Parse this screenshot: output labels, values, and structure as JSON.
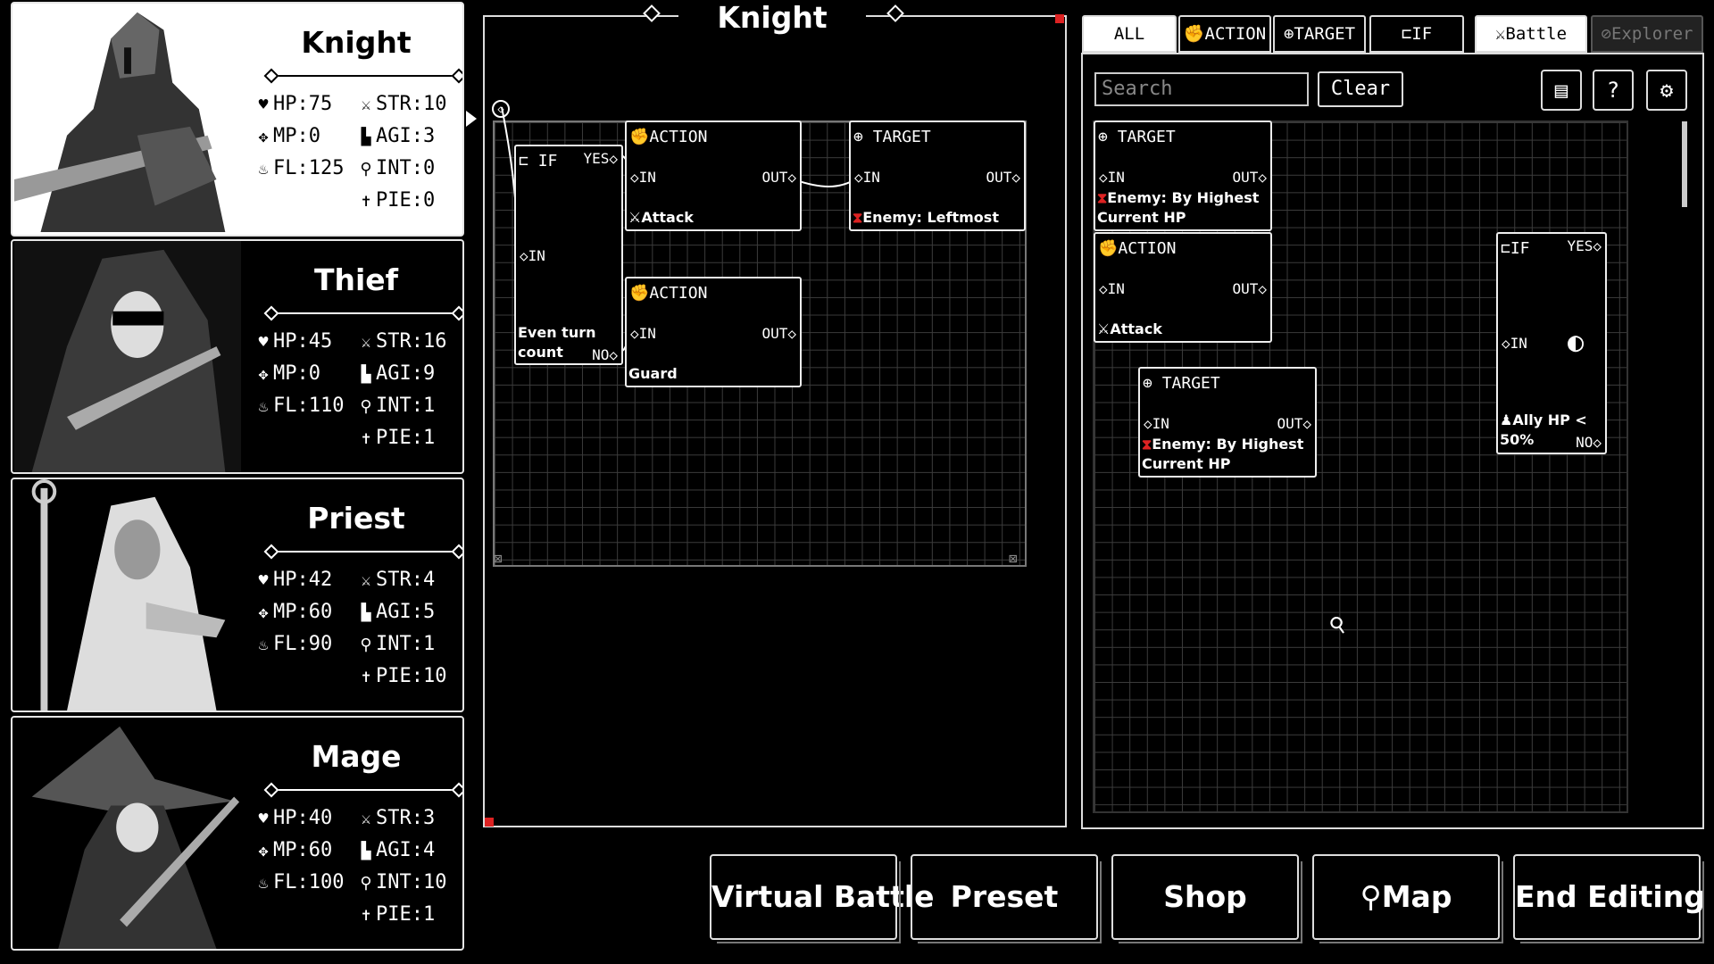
{
  "characters": [
    {
      "name": "Knight",
      "hp": "HP:75",
      "mp": "MP:0",
      "fl": "FL:125",
      "str": "STR:10",
      "agi": "AGI:3",
      "int": "INT:0",
      "pie": "PIE:0"
    },
    {
      "name": "Thief",
      "hp": "HP:45",
      "mp": "MP:0",
      "fl": "FL:110",
      "str": "STR:16",
      "agi": "AGI:9",
      "int": "INT:1",
      "pie": "PIE:1"
    },
    {
      "name": "Priest",
      "hp": "HP:42",
      "mp": "MP:60",
      "fl": "FL:90",
      "str": "STR:4",
      "agi": "AGI:5",
      "int": "INT:1",
      "pie": "PIE:10"
    },
    {
      "name": "Mage",
      "hp": "HP:40",
      "mp": "MP:60",
      "fl": "FL:100",
      "str": "STR:3",
      "agi": "AGI:4",
      "int": "INT:10",
      "pie": "PIE:1"
    }
  ],
  "editor": {
    "title": "Knight",
    "nodes": {
      "if_node": {
        "header": "IF",
        "yes": "YES",
        "in": "IN",
        "no": "NO",
        "condition_line1": "Even turn",
        "condition_line2": "count"
      },
      "action_attack": {
        "header": "ACTION",
        "in": "IN",
        "out": "OUT",
        "value": "Attack"
      },
      "target_left": {
        "header": "TARGET",
        "in": "IN",
        "out": "OUT",
        "value": "Enemy: Leftmost"
      },
      "action_guard": {
        "header": "ACTION",
        "in": "IN",
        "out": "OUT",
        "value": "Guard"
      }
    }
  },
  "palette": {
    "tabs": {
      "all": "ALL",
      "action": "ACTION",
      "target": "TARGET",
      "if": "IF",
      "battle": "Battle",
      "explorer": "Explorer"
    },
    "search_placeholder": "Search",
    "clear_label": "Clear",
    "nodes": {
      "target1": {
        "header": "TARGET",
        "in": "IN",
        "out": "OUT",
        "value_line1": "Enemy: By Highest",
        "value_line2": "Current HP"
      },
      "action1": {
        "header": "ACTION",
        "in": "IN",
        "out": "OUT",
        "value": "Attack"
      },
      "target2": {
        "header": "TARGET",
        "in": "IN",
        "out": "OUT",
        "value_line1": "Enemy: By Highest",
        "value_line2": "Current HP"
      },
      "if1": {
        "header": "IF",
        "yes": "YES",
        "in": "IN",
        "no": "NO",
        "cond_line1": "Ally HP <",
        "cond_line2": "50%"
      }
    }
  },
  "bottom_buttons": {
    "virtual_battle": "Virtual Battle",
    "preset": "Preset",
    "shop": "Shop",
    "map": "Map",
    "end_editing": "End Editing"
  },
  "icons": [
    "heart-icon",
    "mana-icon",
    "flame-icon",
    "sword-icon",
    "boot-icon",
    "key-icon",
    "cross-icon",
    "gear-icon",
    "help-icon",
    "book-icon",
    "pin-icon"
  ],
  "colors": {
    "accent": "#d22222",
    "background": "#000000",
    "foreground": "#ffffff"
  }
}
